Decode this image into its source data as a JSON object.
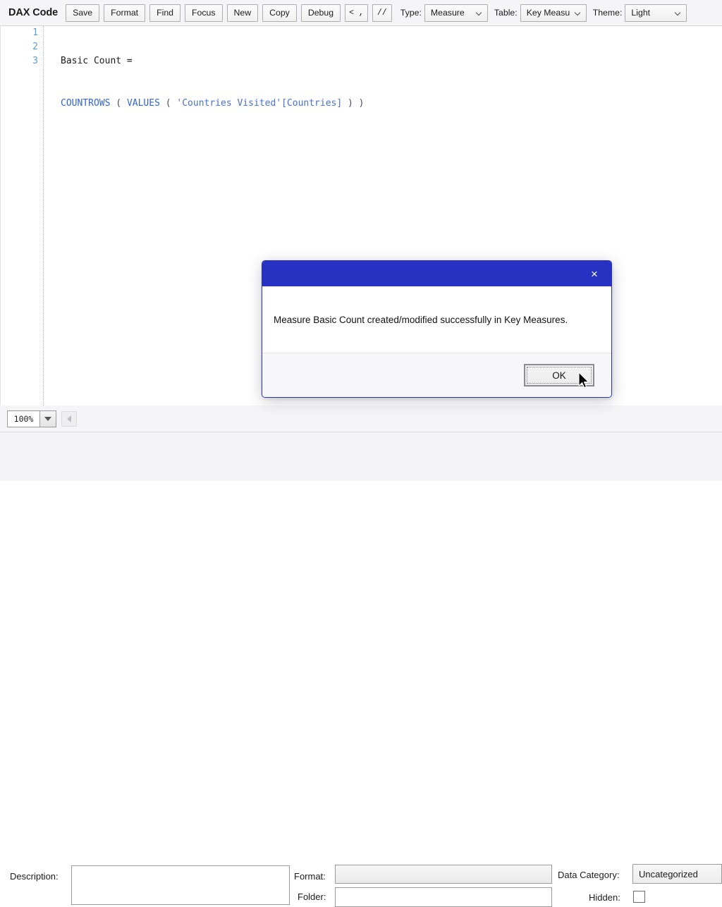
{
  "toolbar": {
    "title": "DAX Code",
    "buttons": [
      {
        "label": "Save",
        "name": "save-button"
      },
      {
        "label": "Format",
        "name": "format-button"
      },
      {
        "label": "Find",
        "name": "find-button"
      },
      {
        "label": "Focus",
        "name": "focus-button"
      },
      {
        "label": "New",
        "name": "new-button"
      },
      {
        "label": "Copy",
        "name": "copy-button"
      },
      {
        "label": "Debug",
        "name": "debug-button"
      }
    ],
    "symbol_buttons": [
      {
        "label": "< ,",
        "name": "leading-comma-button"
      },
      {
        "label": "//",
        "name": "comment-button"
      }
    ],
    "type_label": "Type:",
    "type_value": "Measure",
    "table_label": "Table:",
    "table_value": "Key Measu",
    "theme_label": "Theme:",
    "theme_value": "Light"
  },
  "editor": {
    "line_numbers": [
      "1",
      "2",
      "3"
    ],
    "lines": [
      {
        "measure_name": "Basic Count",
        "equals": " ="
      },
      {
        "fn1": "COUNTROWS",
        "open1": " ( ",
        "fn2": "VALUES",
        "open2": " ( ",
        "table_ref": "'Countries Visited'[Countries]",
        "close": " ) )"
      },
      {
        "empty": ""
      }
    ]
  },
  "statusbar": {
    "zoom_value": "100%"
  },
  "properties": {
    "description_label": "Description:",
    "description_value": "",
    "format_label": "Format:",
    "format_value": "",
    "folder_label": "Folder:",
    "folder_value": "",
    "data_category_label": "Data Category:",
    "data_category_value": "Uncategorized",
    "hidden_label": "Hidden:",
    "hidden_checked": false
  },
  "dialog": {
    "close_glyph": "×",
    "message": "Measure Basic Count created/modified successfully in Key Measures.",
    "ok_label": "OK"
  },
  "colors": {
    "dialog_accent": "#2832C2",
    "line_number": "#5B9BD5",
    "dax_function": "#3465CD",
    "dax_reference": "#4A6FD0",
    "toolbar_bg": "#F5F5F8"
  }
}
